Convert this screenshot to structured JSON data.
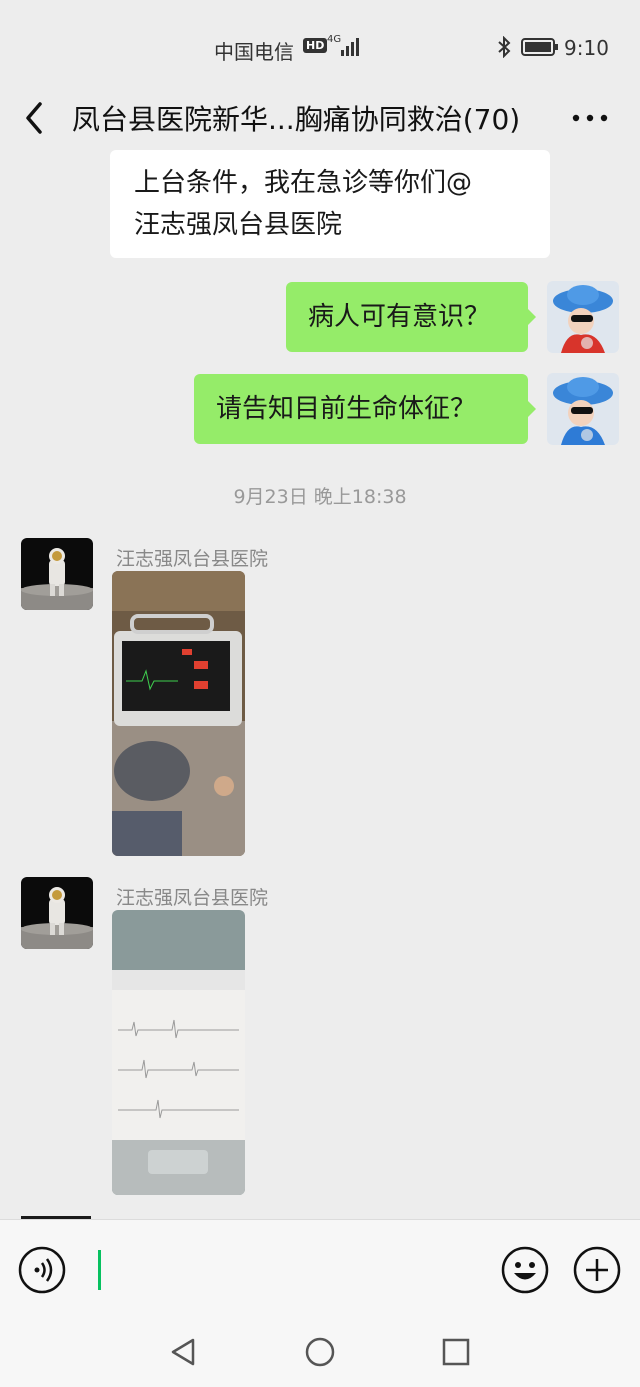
{
  "status_bar": {
    "carrier": "中国电信",
    "hd_badge": "HD",
    "network": "4G",
    "time": "9:10"
  },
  "header": {
    "title": "凤台县医院新华...胸痛协同救治(70)",
    "back_icon": "chevron-left-icon",
    "more_icon": "more-dots-icon"
  },
  "messages": [
    {
      "type": "text",
      "direction": "in",
      "text_line1": "上台条件，我在急诊等你们@",
      "text_line2": "汪志强凤台县医院"
    },
    {
      "type": "text",
      "direction": "out",
      "text": "病人可有意识？"
    },
    {
      "type": "text",
      "direction": "out",
      "text": "请告知目前生命体征？"
    }
  ],
  "timestamp": "9月23日 晚上18:38",
  "image_messages": [
    {
      "sender": "汪志强凤台县医院",
      "content": "monitor-photo"
    },
    {
      "sender": "汪志强凤台县医院",
      "content": "ecg-printout-photo"
    }
  ],
  "input_bar": {
    "voice_icon": "voice-icon",
    "emoji_icon": "emoji-icon",
    "plus_icon": "plus-icon"
  },
  "nav_bar": {
    "back": "triangle-back-icon",
    "home": "circle-home-icon",
    "recents": "square-recents-icon"
  },
  "colors": {
    "background": "#ededed",
    "bubble_out": "#95ec69",
    "bubble_in": "#ffffff",
    "cursor": "#07c160"
  }
}
